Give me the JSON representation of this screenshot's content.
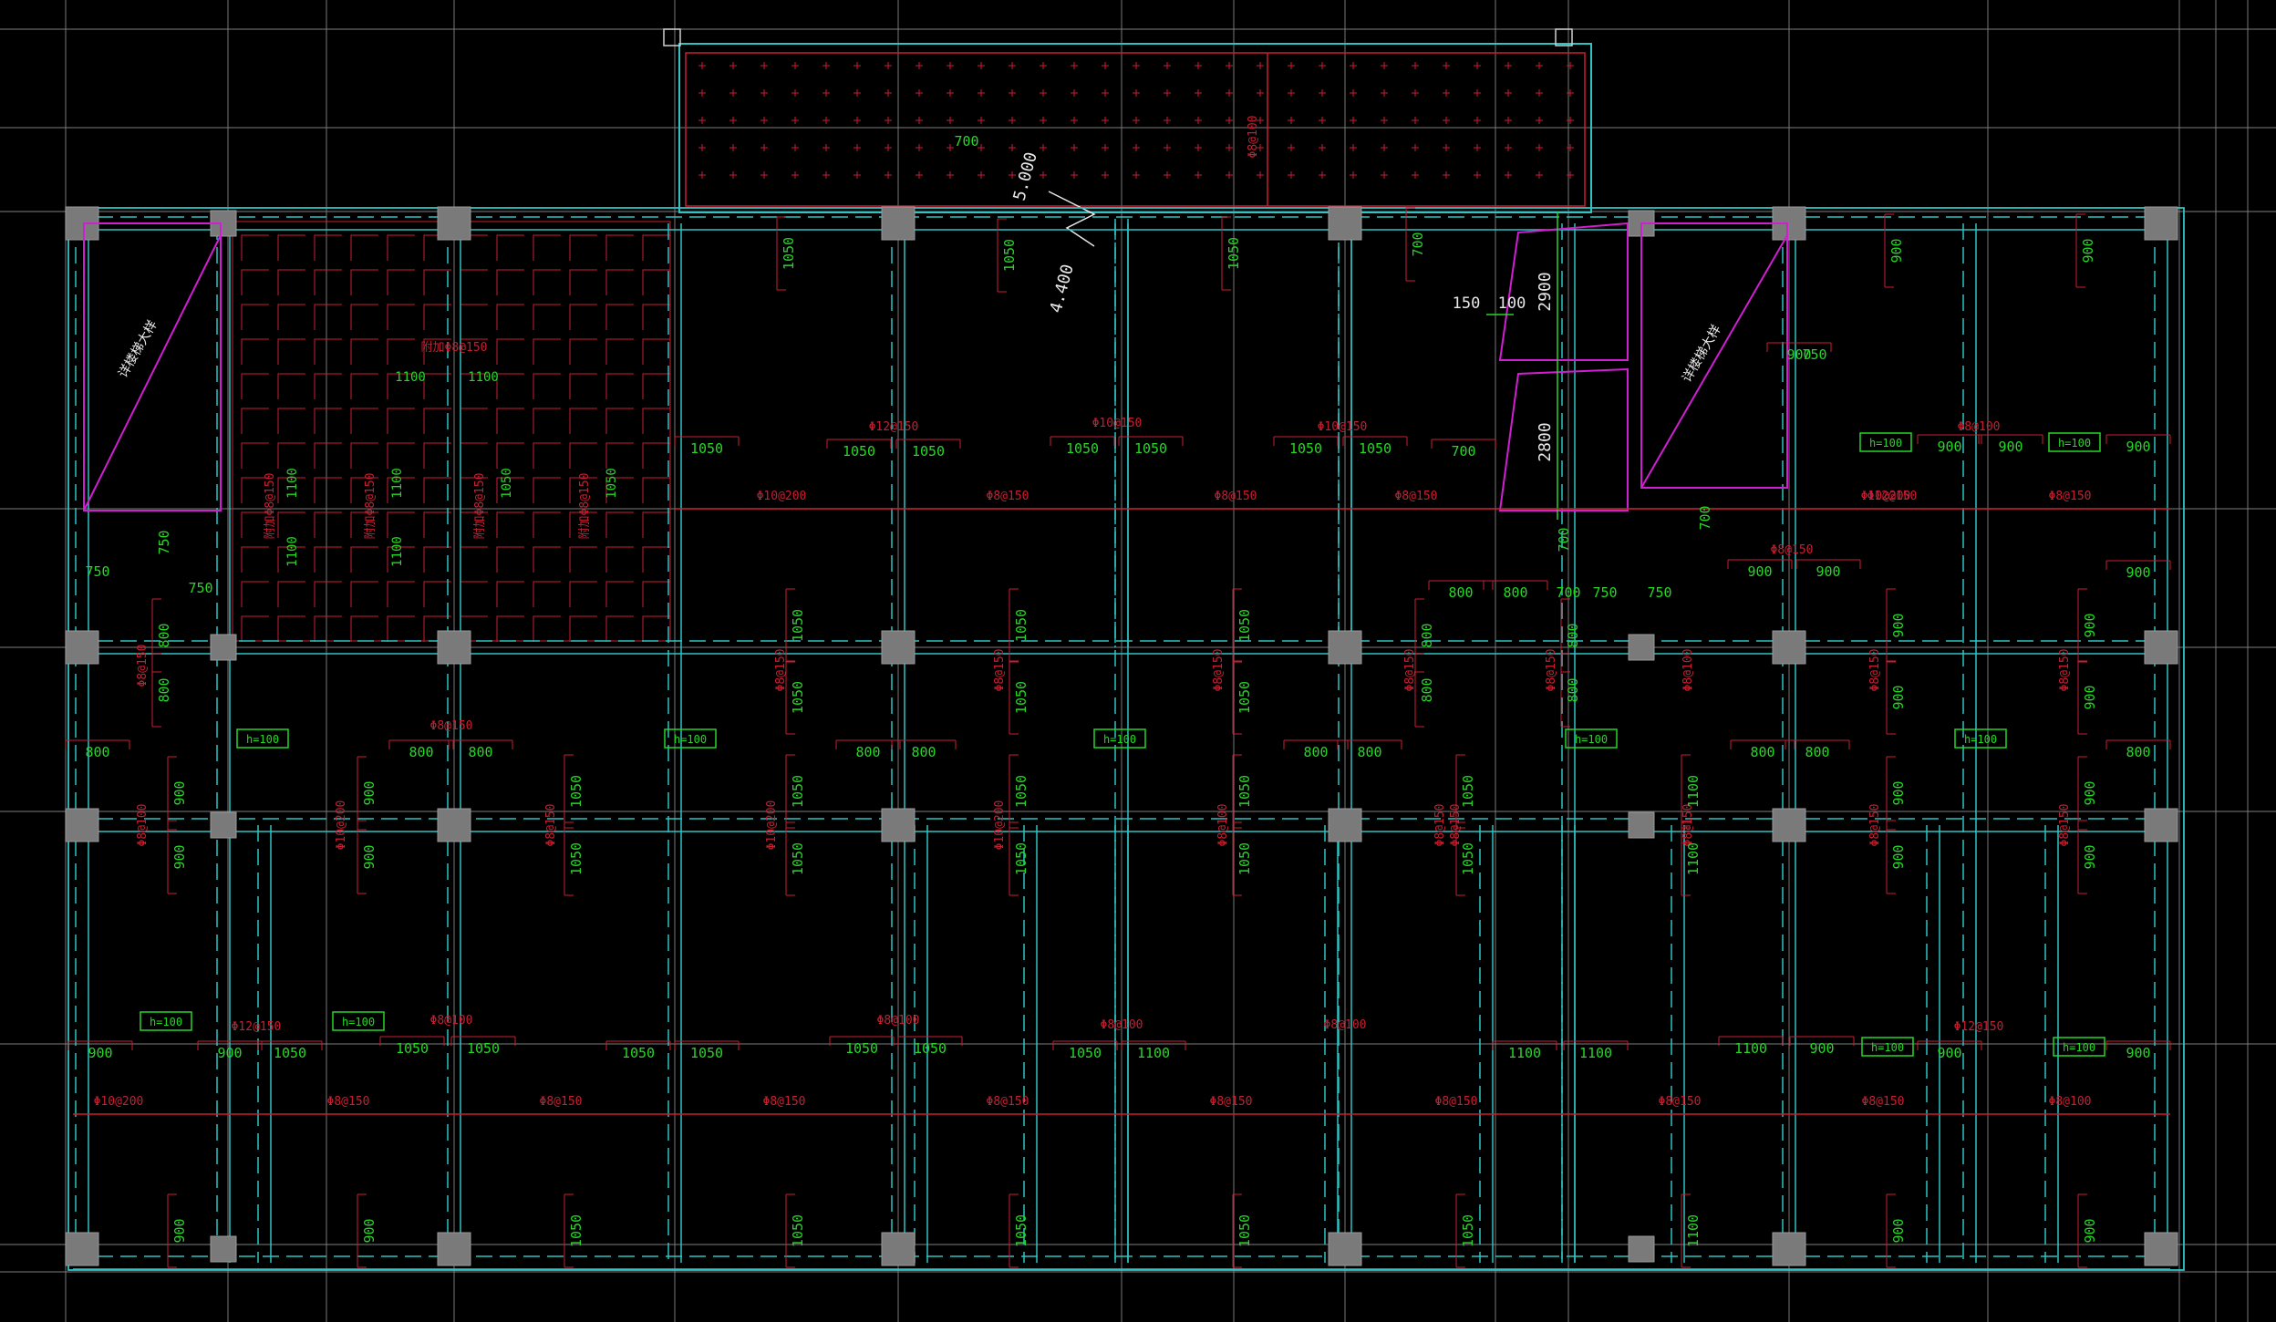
{
  "colors": {
    "background": "#000000",
    "grid_white": "#7f7f7f",
    "beam_cyan": "#2ec4c4",
    "column_gray": "#7a7a7a",
    "rebar_red": "#c81e32",
    "dim_green": "#27d627",
    "accent_magenta": "#d21ed2",
    "label_white": "#e8e8e8"
  },
  "plan": {
    "elevation_top": "5.000",
    "elevation_bottom": "4.400",
    "annotation_150": "150",
    "annotation_100": "100",
    "opening_dim_top": "2900",
    "opening_dim_bottom": "2800",
    "shaft_label_left": "详楼梯大样",
    "shaft_label_right": "详楼梯大样",
    "canopy_rebar": "Φ8@100",
    "slab_thickness_tags": [
      "h=100",
      "h=100",
      "h=100",
      "h=100",
      "h=100",
      "h=100",
      "h=100",
      "h=100",
      "h=100",
      "h=100",
      "h=100"
    ],
    "stair_rebar": [
      "附加Φ8@150",
      "附加Φ8@150",
      "附加Φ8@150",
      "附加Φ8@150",
      "附加Φ8@150"
    ],
    "stair_dims": [
      "1100",
      "1100",
      "1100",
      "1100",
      "1100",
      "1100",
      "1050",
      "1050"
    ],
    "rebar_labels": [
      "Φ12@150",
      "Φ10@150",
      "Φ10@150",
      "Φ10@200",
      "Φ8@150",
      "Φ8@150",
      "Φ8@150",
      "Φ10@200",
      "Φ8@150",
      "Φ8@150",
      "Φ8@150",
      "Φ8@100",
      "Φ8@100",
      "Φ8@100",
      "Φ8@100",
      "Φ8@100",
      "Φ12@150",
      "Φ12@150",
      "Φ12@150",
      "Φ10@200",
      "Φ8@150",
      "Φ8@150",
      "Φ8@150",
      "Φ8@150",
      "Φ8@150",
      "Φ8@150",
      "Φ8@150",
      "Φ8@150",
      "Φ8@100"
    ],
    "vertical_rebar_labels": [
      "Φ8@150",
      "Φ8@100",
      "Φ10@200",
      "Φ10@200",
      "Φ8@150",
      "Φ8@150",
      "Φ8@150",
      "Φ8@150",
      "Φ10@200",
      "Φ8@100",
      "Φ8@150",
      "Φ8@100",
      "Φ8@150",
      "Φ8@150",
      "Φ8@150",
      "Φ8@150",
      "Φ8@150",
      "Φ8@150",
      "Φ8@150",
      "Φ8@150"
    ],
    "dims_row_upper": [
      "1050",
      "1050",
      "1050",
      "1050",
      "1050",
      "1050",
      "1050",
      "700",
      "900",
      "900",
      "900",
      "900",
      "900",
      "900",
      "900"
    ],
    "dims_row_mid": [
      "800",
      "800",
      "800",
      "800",
      "800",
      "800",
      "800",
      "800",
      "800",
      "800",
      "800",
      "800"
    ],
    "dims_row_lower": [
      "900",
      "900",
      "1050",
      "1050",
      "1050",
      "1050",
      "1050",
      "1050",
      "1050",
      "1050",
      "1100",
      "1100",
      "1100",
      "1100",
      "900",
      "900",
      "900"
    ],
    "dims_col_top": [
      "1050",
      "1050",
      "1050",
      "700",
      "900",
      "900"
    ],
    "dims_col_a": [
      "800",
      "800",
      "1050",
      "1050",
      "1050",
      "1050",
      "1050",
      "1050",
      "800",
      "800",
      "800",
      "800",
      "900",
      "900",
      "900",
      "900"
    ],
    "dims_col_b": [
      "900",
      "900",
      "900",
      "900",
      "1050",
      "1050",
      "1050",
      "1050",
      "1050",
      "1050",
      "1050",
      "1050",
      "1050",
      "1050",
      "1100",
      "1100",
      "900",
      "900",
      "900",
      "900"
    ],
    "dims_col_bottom": [
      "900",
      "900",
      "1050",
      "1050",
      "1050",
      "1050",
      "1050",
      "1100",
      "900",
      "900"
    ],
    "dims_misc": [
      "750",
      "750",
      "750",
      "700",
      "700",
      "700",
      "750",
      "750",
      "750",
      "700"
    ]
  }
}
